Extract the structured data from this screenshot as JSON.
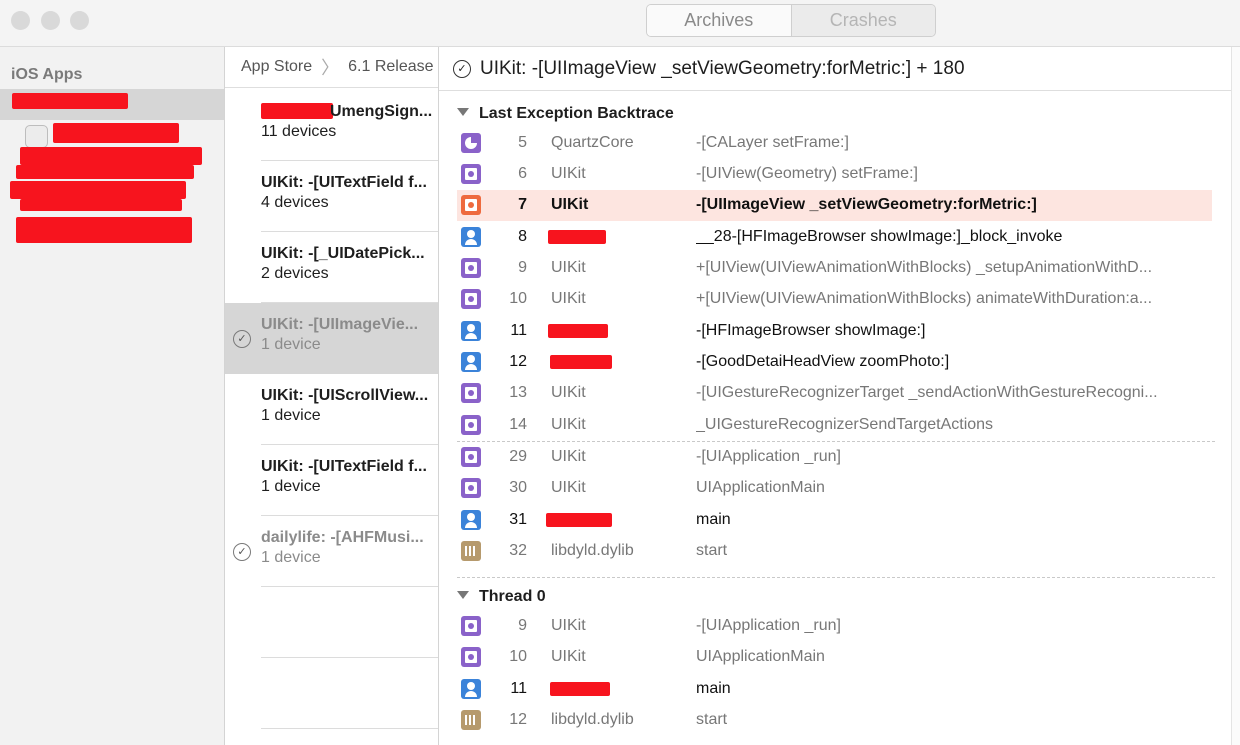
{
  "window": {
    "tabs": [
      {
        "label": "Archives",
        "selected": false
      },
      {
        "label": "Crashes",
        "selected": true
      }
    ]
  },
  "sidebar": {
    "title": "iOS Apps"
  },
  "crash_list": {
    "breadcrumb": [
      "App Store",
      "6.1 Release"
    ],
    "items": [
      {
        "title": "UmengSign...",
        "subtitle": "11 devices",
        "checked": false,
        "selected": false,
        "dimmed": false
      },
      {
        "title": "UIKit: -[UITextField f...",
        "subtitle": "4 devices",
        "checked": false,
        "selected": false,
        "dimmed": false
      },
      {
        "title": "UIKit: -[_UIDatePick...",
        "subtitle": "2 devices",
        "checked": false,
        "selected": false,
        "dimmed": false
      },
      {
        "title": "UIKit: -[UIImageVie...",
        "subtitle": "1 device",
        "checked": true,
        "selected": true,
        "dimmed": false
      },
      {
        "title": "UIKit: -[UIScrollView...",
        "subtitle": "1 device",
        "checked": false,
        "selected": false,
        "dimmed": false
      },
      {
        "title": "UIKit: -[UITextField f...",
        "subtitle": "1 device",
        "checked": false,
        "selected": false,
        "dimmed": false
      },
      {
        "title": "dailylife: -[AHFMusi...",
        "subtitle": "1 device",
        "checked": true,
        "selected": false,
        "dimmed": true
      }
    ]
  },
  "detail": {
    "title": "UIKit: -[UIImageView _setViewGeometry:forMetric:] + 180",
    "sections": [
      {
        "title": "Last Exception Backtrace",
        "frames": [
          {
            "icon": "quartzcore-icon",
            "num": "5",
            "lib": "QuartzCore",
            "symbol": "-[CALayer setFrame:]"
          },
          {
            "icon": "framework-icon",
            "num": "6",
            "lib": "UIKit",
            "symbol": "-[UIView(Geometry) setFrame:]"
          },
          {
            "icon": "crash-framework-icon",
            "num": "7",
            "lib": "UIKit",
            "symbol": "-[UIImageView _setViewGeometry:forMetric:]",
            "highlight": true
          },
          {
            "icon": "user-code-icon",
            "num": "8",
            "lib": "",
            "symbol": "__28-[HFImageBrowser showImage:]_block_invoke"
          },
          {
            "icon": "framework-icon",
            "num": "9",
            "lib": "UIKit",
            "symbol": "+[UIView(UIViewAnimationWithBlocks) _setupAnimationWithD..."
          },
          {
            "icon": "framework-icon",
            "num": "10",
            "lib": "UIKit",
            "symbol": "+[UIView(UIViewAnimationWithBlocks) animateWithDuration:a..."
          },
          {
            "icon": "user-code-icon",
            "num": "11",
            "lib": "",
            "symbol": "-[HFImageBrowser showImage:]"
          },
          {
            "icon": "user-code-icon",
            "num": "12",
            "lib": "",
            "symbol": "-[GoodDetaiHeadView zoomPhoto:]"
          },
          {
            "icon": "framework-icon",
            "num": "13",
            "lib": "UIKit",
            "symbol": "-[UIGestureRecognizerTarget _sendActionWithGestureRecogni..."
          },
          {
            "icon": "framework-icon",
            "num": "14",
            "lib": "UIKit",
            "symbol": "_UIGestureRecognizerSendTargetActions"
          },
          {
            "icon": "framework-icon",
            "num": "29",
            "lib": "UIKit",
            "symbol": "-[UIApplication _run]"
          },
          {
            "icon": "framework-icon",
            "num": "30",
            "lib": "UIKit",
            "symbol": "UIApplicationMain"
          },
          {
            "icon": "user-code-icon",
            "num": "31",
            "lib": "",
            "symbol": "main"
          },
          {
            "icon": "library-icon",
            "num": "32",
            "lib": "libdyld.dylib",
            "symbol": "start"
          }
        ]
      },
      {
        "title": "Thread 0",
        "frames": [
          {
            "icon": "framework-icon",
            "num": "9",
            "lib": "UIKit",
            "symbol": "-[UIApplication _run]"
          },
          {
            "icon": "framework-icon",
            "num": "10",
            "lib": "UIKit",
            "symbol": "UIApplicationMain"
          },
          {
            "icon": "user-code-icon",
            "num": "11",
            "lib": "",
            "symbol": "main"
          },
          {
            "icon": "library-icon",
            "num": "12",
            "lib": "libdyld.dylib",
            "symbol": "start"
          }
        ]
      }
    ]
  },
  "colors": {
    "highlight_row": "#fde5e0",
    "redaction": "#f7141e",
    "framework_icon": "#8a62c9",
    "user_code_icon": "#3b83d9",
    "crash_icon": "#ee6a3e",
    "library_icon": "#b69a6d"
  }
}
